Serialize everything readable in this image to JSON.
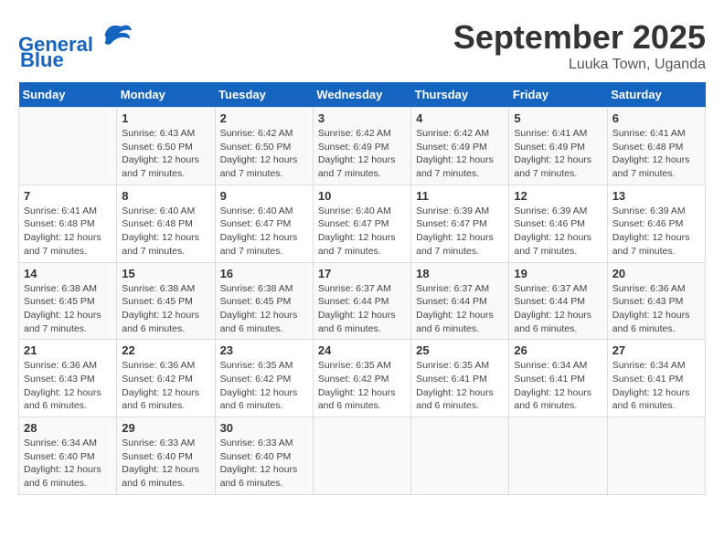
{
  "header": {
    "logo_line1": "General",
    "logo_line2": "Blue",
    "month": "September 2025",
    "location": "Luuka Town, Uganda"
  },
  "days_of_week": [
    "Sunday",
    "Monday",
    "Tuesday",
    "Wednesday",
    "Thursday",
    "Friday",
    "Saturday"
  ],
  "weeks": [
    [
      {
        "num": "",
        "info": ""
      },
      {
        "num": "1",
        "info": "Sunrise: 6:43 AM\nSunset: 6:50 PM\nDaylight: 12 hours\nand 7 minutes."
      },
      {
        "num": "2",
        "info": "Sunrise: 6:42 AM\nSunset: 6:50 PM\nDaylight: 12 hours\nand 7 minutes."
      },
      {
        "num": "3",
        "info": "Sunrise: 6:42 AM\nSunset: 6:49 PM\nDaylight: 12 hours\nand 7 minutes."
      },
      {
        "num": "4",
        "info": "Sunrise: 6:42 AM\nSunset: 6:49 PM\nDaylight: 12 hours\nand 7 minutes."
      },
      {
        "num": "5",
        "info": "Sunrise: 6:41 AM\nSunset: 6:49 PM\nDaylight: 12 hours\nand 7 minutes."
      },
      {
        "num": "6",
        "info": "Sunrise: 6:41 AM\nSunset: 6:48 PM\nDaylight: 12 hours\nand 7 minutes."
      }
    ],
    [
      {
        "num": "7",
        "info": "Sunrise: 6:41 AM\nSunset: 6:48 PM\nDaylight: 12 hours\nand 7 minutes."
      },
      {
        "num": "8",
        "info": "Sunrise: 6:40 AM\nSunset: 6:48 PM\nDaylight: 12 hours\nand 7 minutes."
      },
      {
        "num": "9",
        "info": "Sunrise: 6:40 AM\nSunset: 6:47 PM\nDaylight: 12 hours\nand 7 minutes."
      },
      {
        "num": "10",
        "info": "Sunrise: 6:40 AM\nSunset: 6:47 PM\nDaylight: 12 hours\nand 7 minutes."
      },
      {
        "num": "11",
        "info": "Sunrise: 6:39 AM\nSunset: 6:47 PM\nDaylight: 12 hours\nand 7 minutes."
      },
      {
        "num": "12",
        "info": "Sunrise: 6:39 AM\nSunset: 6:46 PM\nDaylight: 12 hours\nand 7 minutes."
      },
      {
        "num": "13",
        "info": "Sunrise: 6:39 AM\nSunset: 6:46 PM\nDaylight: 12 hours\nand 7 minutes."
      }
    ],
    [
      {
        "num": "14",
        "info": "Sunrise: 6:38 AM\nSunset: 6:45 PM\nDaylight: 12 hours\nand 7 minutes."
      },
      {
        "num": "15",
        "info": "Sunrise: 6:38 AM\nSunset: 6:45 PM\nDaylight: 12 hours\nand 6 minutes."
      },
      {
        "num": "16",
        "info": "Sunrise: 6:38 AM\nSunset: 6:45 PM\nDaylight: 12 hours\nand 6 minutes."
      },
      {
        "num": "17",
        "info": "Sunrise: 6:37 AM\nSunset: 6:44 PM\nDaylight: 12 hours\nand 6 minutes."
      },
      {
        "num": "18",
        "info": "Sunrise: 6:37 AM\nSunset: 6:44 PM\nDaylight: 12 hours\nand 6 minutes."
      },
      {
        "num": "19",
        "info": "Sunrise: 6:37 AM\nSunset: 6:44 PM\nDaylight: 12 hours\nand 6 minutes."
      },
      {
        "num": "20",
        "info": "Sunrise: 6:36 AM\nSunset: 6:43 PM\nDaylight: 12 hours\nand 6 minutes."
      }
    ],
    [
      {
        "num": "21",
        "info": "Sunrise: 6:36 AM\nSunset: 6:43 PM\nDaylight: 12 hours\nand 6 minutes."
      },
      {
        "num": "22",
        "info": "Sunrise: 6:36 AM\nSunset: 6:42 PM\nDaylight: 12 hours\nand 6 minutes."
      },
      {
        "num": "23",
        "info": "Sunrise: 6:35 AM\nSunset: 6:42 PM\nDaylight: 12 hours\nand 6 minutes."
      },
      {
        "num": "24",
        "info": "Sunrise: 6:35 AM\nSunset: 6:42 PM\nDaylight: 12 hours\nand 6 minutes."
      },
      {
        "num": "25",
        "info": "Sunrise: 6:35 AM\nSunset: 6:41 PM\nDaylight: 12 hours\nand 6 minutes."
      },
      {
        "num": "26",
        "info": "Sunrise: 6:34 AM\nSunset: 6:41 PM\nDaylight: 12 hours\nand 6 minutes."
      },
      {
        "num": "27",
        "info": "Sunrise: 6:34 AM\nSunset: 6:41 PM\nDaylight: 12 hours\nand 6 minutes."
      }
    ],
    [
      {
        "num": "28",
        "info": "Sunrise: 6:34 AM\nSunset: 6:40 PM\nDaylight: 12 hours\nand 6 minutes."
      },
      {
        "num": "29",
        "info": "Sunrise: 6:33 AM\nSunset: 6:40 PM\nDaylight: 12 hours\nand 6 minutes."
      },
      {
        "num": "30",
        "info": "Sunrise: 6:33 AM\nSunset: 6:40 PM\nDaylight: 12 hours\nand 6 minutes."
      },
      {
        "num": "",
        "info": ""
      },
      {
        "num": "",
        "info": ""
      },
      {
        "num": "",
        "info": ""
      },
      {
        "num": "",
        "info": ""
      }
    ]
  ]
}
